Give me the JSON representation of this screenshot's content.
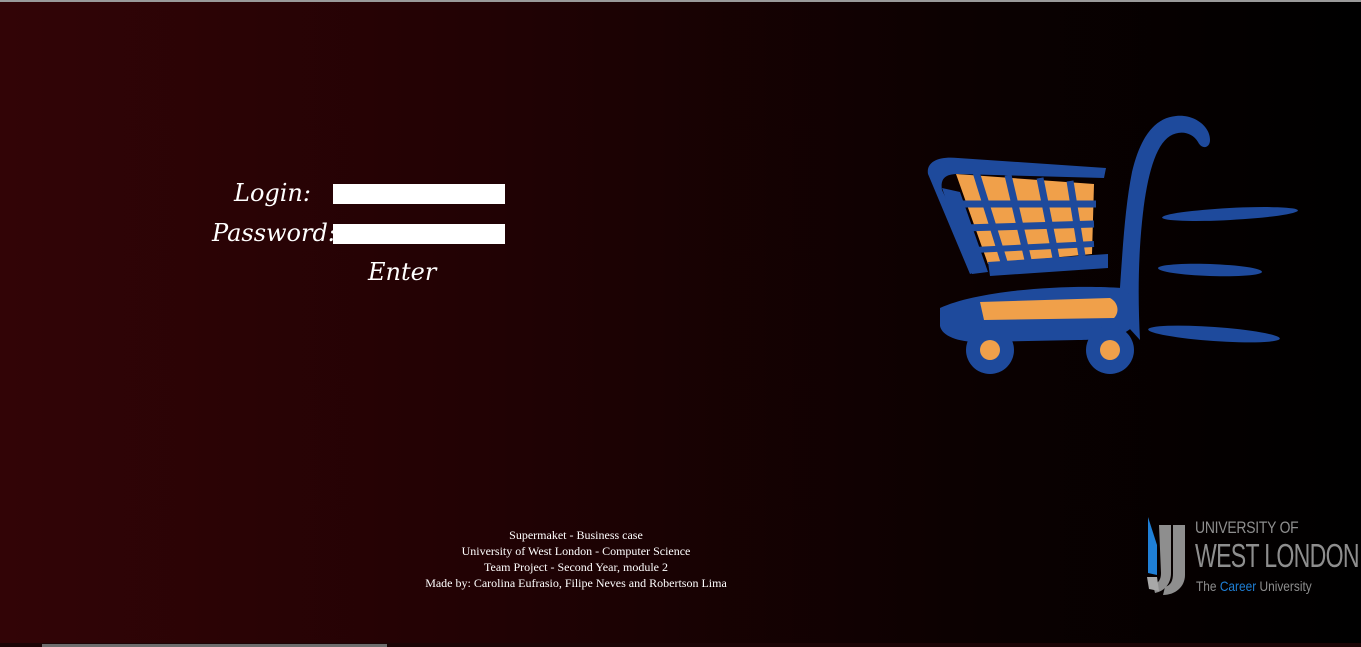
{
  "form": {
    "login_label": "Login:",
    "login_value": "",
    "password_label": "Password:",
    "password_value": "",
    "enter_label": "Enter"
  },
  "cart_image": {
    "icon": "shopping-cart-icon",
    "colors": {
      "frame": "#1e4a9c",
      "fill": "#f0a04a"
    }
  },
  "footer": {
    "lines": [
      "Supermaket - Business case",
      "University of West London - Computer Science",
      "Team Project - Second Year, module 2",
      "Made by: Carolina Eufrasio, Filipe Neves and Robertson Lima"
    ]
  },
  "logo": {
    "line1": "UNIVERSITY OF",
    "line2": "WEST LONDON",
    "tagline_prefix": "The ",
    "tagline_highlight": "Career",
    "tagline_suffix": " University",
    "colors": {
      "text": "#8e8e8e",
      "accent": "#1f7fd6"
    }
  },
  "theme": {
    "background_left": "#320406",
    "background_right": "#000000",
    "text": "#ffffff"
  }
}
